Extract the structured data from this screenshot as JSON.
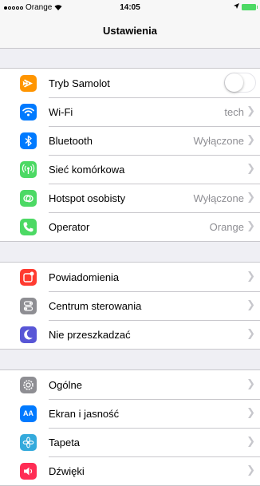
{
  "status_bar": {
    "carrier": "Orange",
    "time": "14:05",
    "signal_bars": 1,
    "battery_color": "#4cd964"
  },
  "nav": {
    "title": "Ustawienia"
  },
  "groups": [
    {
      "items": [
        {
          "label": "Tryb Samolot",
          "icon": "airplane-icon",
          "color": "#ff9500",
          "toggle": false
        },
        {
          "label": "Wi-Fi",
          "value": "tech",
          "icon": "wifi-icon",
          "color": "#007aff"
        },
        {
          "label": "Bluetooth",
          "value": "Wyłączone",
          "icon": "bluetooth-icon",
          "color": "#007aff"
        },
        {
          "label": "Sieć komórkowa",
          "value": "",
          "icon": "antenna-icon",
          "color": "#4cd964"
        },
        {
          "label": "Hotspot osobisty",
          "value": "Wyłączone",
          "icon": "hotspot-icon",
          "color": "#4cd964"
        },
        {
          "label": "Operator",
          "value": "Orange",
          "icon": "phone-icon",
          "color": "#4cd964"
        }
      ]
    },
    {
      "items": [
        {
          "label": "Powiadomienia",
          "icon": "notifications-icon",
          "color": "#ff3b30"
        },
        {
          "label": "Centrum sterowania",
          "icon": "control-center-icon",
          "color": "#8e8e93"
        },
        {
          "label": "Nie przeszkadzać",
          "icon": "moon-icon",
          "color": "#5856d6"
        }
      ]
    },
    {
      "items": [
        {
          "label": "Ogólne",
          "icon": "gear-icon",
          "color": "#8e8e93"
        },
        {
          "label": "Ekran i jasność",
          "icon": "text-size-icon",
          "color": "#007aff"
        },
        {
          "label": "Tapeta",
          "icon": "wallpaper-icon",
          "color": "#34aadc"
        },
        {
          "label": "Dźwięki",
          "icon": "speaker-icon",
          "color": "#ff2d55"
        }
      ]
    }
  ]
}
